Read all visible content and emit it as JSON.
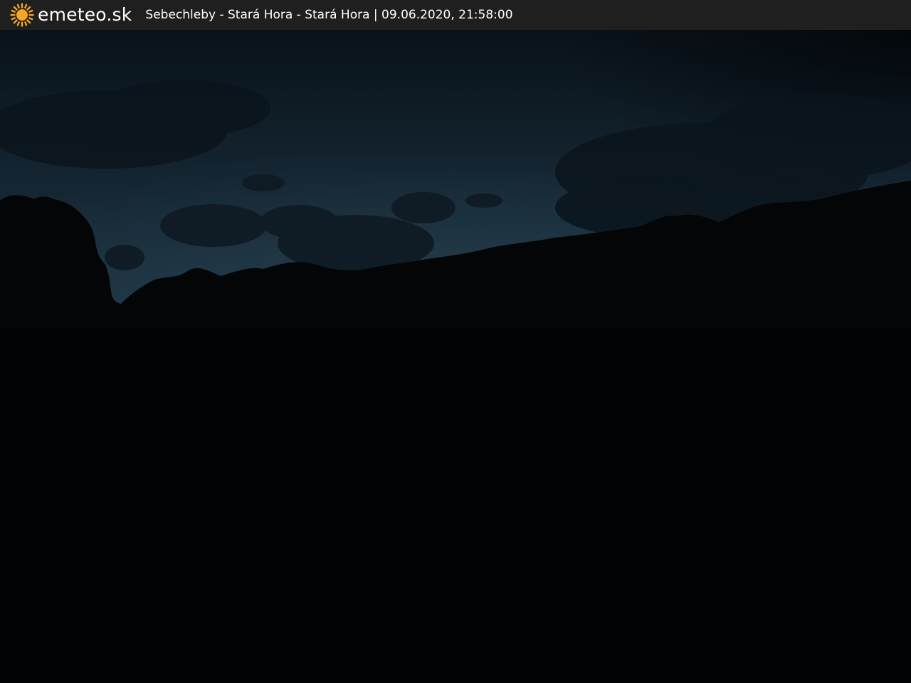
{
  "header": {
    "logo_icon": "sun-icon",
    "brand": "emeteo.sk",
    "caption": "Sebechleby - Stará Hora - Stará Hora | 09.06.2020, 21:58:00"
  },
  "colors": {
    "bar_background": "#1f1f1f",
    "sun": "#f5a623",
    "sky_top": "#0b1620",
    "sky_horizon": "#1c3342",
    "ground": "#020304"
  }
}
